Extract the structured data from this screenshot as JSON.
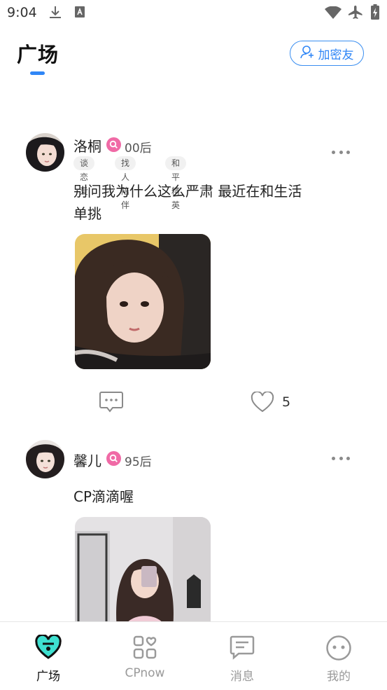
{
  "status_bar": {
    "time": "9:04",
    "icons": [
      "download-icon",
      "font-icon",
      "wifi-icon",
      "airplane-mode-icon",
      "battery-charging-icon"
    ]
  },
  "header": {
    "title": "广场",
    "add_friend_label": "加密友",
    "accent_color": "#2f86f6"
  },
  "posts": [
    {
      "username": "洛桐",
      "gender_icon": "female-search-badge",
      "age": "00后",
      "tags": [
        "谈恋爱",
        "找人陪伴",
        "和平精英"
      ],
      "text": "别问我为什么这么严肃 最近在和生活单挑",
      "like_count": "5"
    },
    {
      "username": "馨儿",
      "gender_icon": "female-search-badge",
      "age": "95后",
      "tags": [],
      "text": "CP滴滴喔"
    }
  ],
  "bottom_nav": {
    "items": [
      {
        "label": "广场",
        "icon": "heart-square-icon",
        "active": true
      },
      {
        "label": "CPnow",
        "icon": "grid-heart-icon",
        "active": false
      },
      {
        "label": "消息",
        "icon": "message-icon",
        "active": false
      },
      {
        "label": "我的",
        "icon": "face-icon",
        "active": false
      }
    ]
  },
  "colors": {
    "badge_pink": "#f06aa6",
    "nav_active_teal": "#3ee0d0",
    "nav_inactive": "#9a9a9a"
  }
}
